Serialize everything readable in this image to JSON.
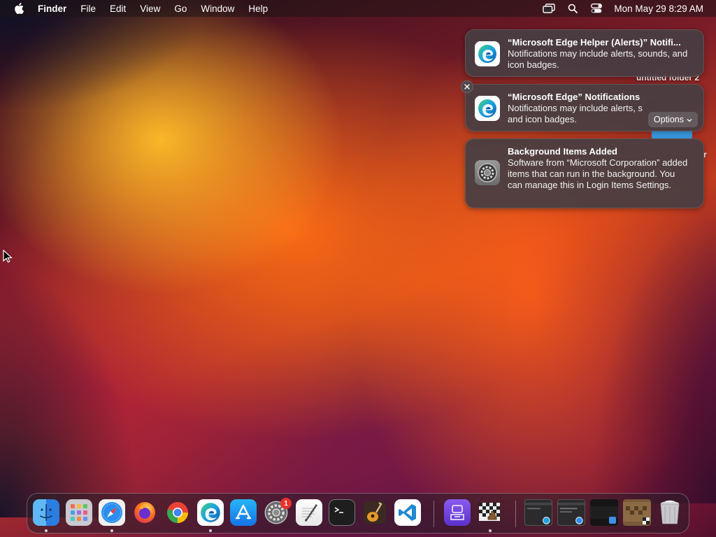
{
  "menubar": {
    "apple_icon": "apple-logo-icon",
    "app_name": "Finder",
    "menus": [
      "File",
      "Edit",
      "View",
      "Go",
      "Window",
      "Help"
    ],
    "status_icons": [
      "screen-mirroring-icon",
      "spotlight-search-icon",
      "control-center-icon"
    ],
    "clock": "Mon May 29  8:29 AM"
  },
  "notifications": [
    {
      "app_icon": "microsoft-edge-icon",
      "title": "“Microsoft Edge Helper (Alerts)” Notifi...",
      "body": "Notifications may include alerts, sounds, and icon badges."
    },
    {
      "app_icon": "microsoft-edge-icon",
      "title": "“Microsoft Edge” Notifications",
      "body_line1": "Notifications may include alerts, s",
      "body_line2": "and icon badges.",
      "options_label": "Options",
      "close_icon": "close-icon"
    },
    {
      "app_icon": "system-settings-gear-icon",
      "title": "Background Items Added",
      "body": "Software from “Microsoft Corporation” added items that can run in the background. You can manage this in Login Items Settings."
    }
  ],
  "desktop": {
    "folder_label": "untitled folder 2",
    "partial_label": "r"
  },
  "dock": {
    "apps": [
      {
        "name": "Finder",
        "icon": "finder-icon",
        "running": true
      },
      {
        "name": "Launchpad",
        "icon": "launchpad-icon",
        "running": false
      },
      {
        "name": "Safari",
        "icon": "safari-icon",
        "running": true
      },
      {
        "name": "Firefox",
        "icon": "firefox-icon",
        "running": false
      },
      {
        "name": "Google Chrome",
        "icon": "chrome-icon",
        "running": false
      },
      {
        "name": "Microsoft Edge",
        "icon": "edge-icon",
        "running": true
      },
      {
        "name": "App Store",
        "icon": "app-store-icon",
        "running": false
      },
      {
        "name": "System Settings",
        "icon": "system-settings-icon",
        "running": false,
        "badge": "1"
      },
      {
        "name": "TextEdit",
        "icon": "textedit-icon",
        "running": false
      },
      {
        "name": "Terminal",
        "icon": "terminal-icon",
        "running": false
      },
      {
        "name": "GarageBand",
        "icon": "garageband-icon",
        "running": false
      },
      {
        "name": "Visual Studio Code",
        "icon": "vscode-icon",
        "running": false
      },
      {
        "name": "Simulator Archive",
        "icon": "archive-utility-icon",
        "running": false
      },
      {
        "name": "Chess",
        "icon": "chess-icon",
        "running": true
      }
    ],
    "minimized": [
      {
        "name": "Edge window",
        "icon": "minimized-edge-window-icon"
      },
      {
        "name": "Safari window",
        "icon": "minimized-safari-window-icon"
      },
      {
        "name": "Finder window",
        "icon": "minimized-finder-window-icon"
      },
      {
        "name": "Chess window",
        "icon": "minimized-chess-window-icon"
      }
    ],
    "trash": {
      "name": "Trash",
      "icon": "trash-icon"
    }
  }
}
